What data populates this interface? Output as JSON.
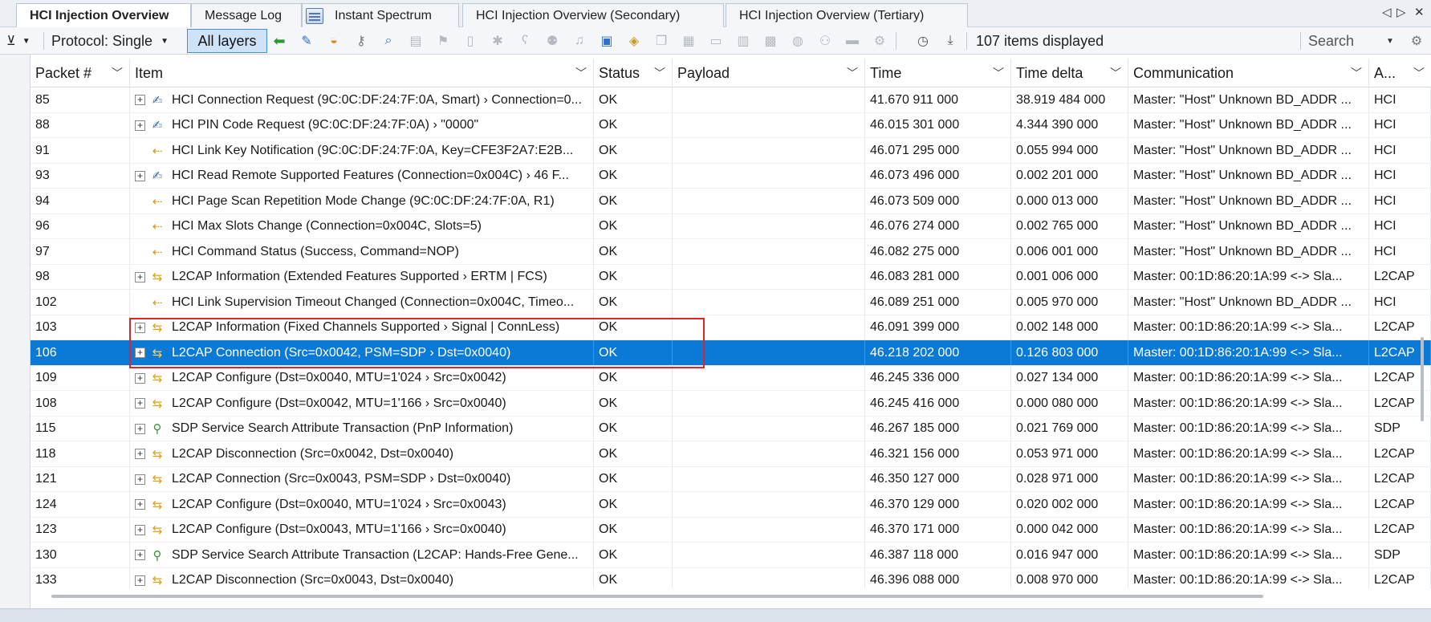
{
  "tabs": [
    {
      "label": "HCI Injection Overview",
      "active": true
    },
    {
      "label": "Message Log",
      "active": false
    },
    {
      "label": "Instant Spectrum",
      "active": false,
      "icon": "spectrum-icon"
    },
    {
      "label": "HCI Injection Overview (Secondary)",
      "active": false
    },
    {
      "label": "HCI Injection Overview (Tertiary)",
      "active": false
    }
  ],
  "tab_nav": {
    "prev": "◁",
    "next": "▷",
    "close": "✕"
  },
  "toolbar": {
    "filter_icon": "filter-icon",
    "protocol_label": "Protocol: Single",
    "all_layers_label": "All layers",
    "items_displayed": "107 items displayed",
    "search_placeholder": "Search"
  },
  "columns": [
    {
      "label": "Packet #"
    },
    {
      "label": "Item"
    },
    {
      "label": "Status"
    },
    {
      "label": "Payload"
    },
    {
      "label": "Time"
    },
    {
      "label": "Time delta"
    },
    {
      "label": "Communication"
    },
    {
      "label": "A..."
    }
  ],
  "rows": [
    {
      "packet": "85",
      "expand": true,
      "icon": "hci",
      "item": "HCI Connection Request (9C:0C:DF:24:7F:0A, Smart) › Connection=0...",
      "status": "OK",
      "payload": "",
      "time": "41.670 911 000",
      "delta": "38.919 484 000",
      "comm": "Master: \"Host\" Unknown BD_ADDR ...",
      "a": "HCI"
    },
    {
      "packet": "88",
      "expand": true,
      "icon": "hci",
      "item": "HCI PIN Code Request (9C:0C:DF:24:7F:0A) › \"0000\"",
      "status": "OK",
      "payload": "",
      "time": "46.015 301 000",
      "delta": "4.344 390 000",
      "comm": "Master: \"Host\" Unknown BD_ADDR ...",
      "a": "HCI"
    },
    {
      "packet": "91",
      "expand": false,
      "icon": "evt",
      "item": "HCI Link Key Notification (9C:0C:DF:24:7F:0A, Key=CFE3F2A7:E2B...",
      "status": "OK",
      "payload": "",
      "time": "46.071 295 000",
      "delta": "0.055 994 000",
      "comm": "Master: \"Host\" Unknown BD_ADDR ...",
      "a": "HCI"
    },
    {
      "packet": "93",
      "expand": true,
      "icon": "hci",
      "item": "HCI Read Remote Supported Features (Connection=0x004C) › 46 F...",
      "status": "OK",
      "payload": "",
      "time": "46.073 496 000",
      "delta": "0.002 201 000",
      "comm": "Master: \"Host\" Unknown BD_ADDR ...",
      "a": "HCI"
    },
    {
      "packet": "94",
      "expand": false,
      "icon": "evt",
      "item": "HCI Page Scan Repetition Mode Change (9C:0C:DF:24:7F:0A, R1)",
      "status": "OK",
      "payload": "",
      "time": "46.073 509 000",
      "delta": "0.000 013 000",
      "comm": "Master: \"Host\" Unknown BD_ADDR ...",
      "a": "HCI"
    },
    {
      "packet": "96",
      "expand": false,
      "icon": "evt",
      "item": "HCI Max Slots Change (Connection=0x004C, Slots=5)",
      "status": "OK",
      "payload": "",
      "time": "46.076 274 000",
      "delta": "0.002 765 000",
      "comm": "Master: \"Host\" Unknown BD_ADDR ...",
      "a": "HCI"
    },
    {
      "packet": "97",
      "expand": false,
      "icon": "evt",
      "item": "HCI Command Status (Success, Command=NOP)",
      "status": "OK",
      "payload": "",
      "time": "46.082 275 000",
      "delta": "0.006 001 000",
      "comm": "Master: \"Host\" Unknown BD_ADDR ...",
      "a": "HCI"
    },
    {
      "packet": "98",
      "expand": true,
      "icon": "l2cap",
      "item": "L2CAP Information (Extended Features Supported › ERTM | FCS)",
      "status": "OK",
      "payload": "",
      "time": "46.083 281 000",
      "delta": "0.001 006 000",
      "comm": "Master: 00:1D:86:20:1A:99 <-> Sla...",
      "a": "L2CAP"
    },
    {
      "packet": "102",
      "expand": false,
      "icon": "evt",
      "item": "HCI Link Supervision Timeout Changed (Connection=0x004C, Timeo...",
      "status": "OK",
      "payload": "",
      "time": "46.089 251 000",
      "delta": "0.005 970 000",
      "comm": "Master: \"Host\" Unknown BD_ADDR ...",
      "a": "HCI"
    },
    {
      "packet": "103",
      "expand": true,
      "icon": "l2cap",
      "item": "L2CAP Information (Fixed Channels Supported › Signal | ConnLess)",
      "status": "OK",
      "payload": "",
      "time": "46.091 399 000",
      "delta": "0.002 148 000",
      "comm": "Master: 00:1D:86:20:1A:99 <-> Sla...",
      "a": "L2CAP"
    },
    {
      "packet": "106",
      "expand": true,
      "icon": "l2cap",
      "item": "L2CAP Connection (Src=0x0042, PSM=SDP › Dst=0x0040)",
      "status": "OK",
      "payload": "",
      "time": "46.218 202 000",
      "delta": "0.126 803 000",
      "comm": "Master: 00:1D:86:20:1A:99 <-> Sla...",
      "a": "L2CAP",
      "selected": true
    },
    {
      "packet": "109",
      "expand": true,
      "icon": "l2cap",
      "item": "L2CAP Configure (Dst=0x0040, MTU=1'024 › Src=0x0042)",
      "status": "OK",
      "payload": "",
      "time": "46.245 336 000",
      "delta": "0.027 134 000",
      "comm": "Master: 00:1D:86:20:1A:99 <-> Sla...",
      "a": "L2CAP"
    },
    {
      "packet": "108",
      "expand": true,
      "icon": "l2cap",
      "item": "L2CAP Configure (Dst=0x0042, MTU=1'166 › Src=0x0040)",
      "status": "OK",
      "payload": "",
      "time": "46.245 416 000",
      "delta": "0.000 080 000",
      "comm": "Master: 00:1D:86:20:1A:99 <-> Sla...",
      "a": "L2CAP"
    },
    {
      "packet": "115",
      "expand": true,
      "icon": "sdp",
      "item": "SDP Service Search Attribute Transaction (PnP Information)",
      "status": "OK",
      "payload": "",
      "time": "46.267 185 000",
      "delta": "0.021 769 000",
      "comm": "Master: 00:1D:86:20:1A:99 <-> Sla...",
      "a": "SDP"
    },
    {
      "packet": "118",
      "expand": true,
      "icon": "l2cap",
      "item": "L2CAP Disconnection (Src=0x0042, Dst=0x0040)",
      "status": "OK",
      "payload": "",
      "time": "46.321 156 000",
      "delta": "0.053 971 000",
      "comm": "Master: 00:1D:86:20:1A:99 <-> Sla...",
      "a": "L2CAP"
    },
    {
      "packet": "121",
      "expand": true,
      "icon": "l2cap",
      "item": "L2CAP Connection (Src=0x0043, PSM=SDP › Dst=0x0040)",
      "status": "OK",
      "payload": "",
      "time": "46.350 127 000",
      "delta": "0.028 971 000",
      "comm": "Master: 00:1D:86:20:1A:99 <-> Sla...",
      "a": "L2CAP"
    },
    {
      "packet": "124",
      "expand": true,
      "icon": "l2cap",
      "item": "L2CAP Configure (Dst=0x0040, MTU=1'024 › Src=0x0043)",
      "status": "OK",
      "payload": "",
      "time": "46.370 129 000",
      "delta": "0.020 002 000",
      "comm": "Master: 00:1D:86:20:1A:99 <-> Sla...",
      "a": "L2CAP"
    },
    {
      "packet": "123",
      "expand": true,
      "icon": "l2cap",
      "item": "L2CAP Configure (Dst=0x0043, MTU=1'166 › Src=0x0040)",
      "status": "OK",
      "payload": "",
      "time": "46.370 171 000",
      "delta": "0.000 042 000",
      "comm": "Master: 00:1D:86:20:1A:99 <-> Sla...",
      "a": "L2CAP"
    },
    {
      "packet": "130",
      "expand": true,
      "icon": "sdp",
      "item": "SDP Service Search Attribute Transaction (L2CAP: Hands-Free Gene...",
      "status": "OK",
      "payload": "",
      "time": "46.387 118 000",
      "delta": "0.016 947 000",
      "comm": "Master: 00:1D:86:20:1A:99 <-> Sla...",
      "a": "SDP"
    },
    {
      "packet": "133",
      "expand": true,
      "icon": "l2cap",
      "item": "L2CAP Disconnection (Src=0x0043, Dst=0x0040)",
      "status": "OK",
      "payload": "",
      "time": "46.396 088 000",
      "delta": "0.008 970 000",
      "comm": "Master: 00:1D:86:20:1A:99 <-> Sla...",
      "a": "L2CAP"
    }
  ],
  "colors": {
    "selection": "#0a7ad6",
    "highlight_box": "#e0222b",
    "all_layers_bg": "#cfe3f8"
  }
}
